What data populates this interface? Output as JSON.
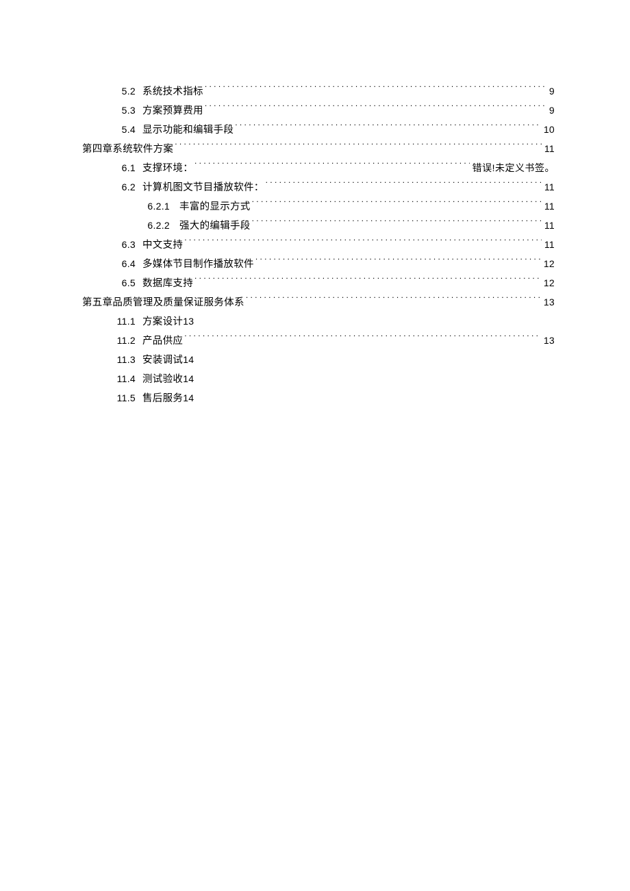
{
  "toc": [
    {
      "level": 1,
      "num": "5.2",
      "title": "系统技术指标",
      "leader": true,
      "page": "9"
    },
    {
      "level": 1,
      "num": "5.3",
      "title": "方案预算费用",
      "leader": true,
      "page": "9"
    },
    {
      "level": 1,
      "num": "5.4",
      "title": "显示功能和编辑手段",
      "leader": true,
      "page": "10"
    },
    {
      "level": 0,
      "num": "",
      "title": "第四章系统软件方案",
      "leader": true,
      "page": "11"
    },
    {
      "level": 1,
      "num": "6.1",
      "title": "支撑环境：",
      "leader": true,
      "page": "错误!未定义书签。",
      "error": true
    },
    {
      "level": 1,
      "num": "6.2",
      "title": "计算机图文节目播放软件：",
      "leader": true,
      "page": "11"
    },
    {
      "level": 2,
      "num": "6.2.1",
      "title": "丰富的显示方式",
      "leader": true,
      "page": "11"
    },
    {
      "level": 2,
      "num": "6.2.2",
      "title": "强大的编辑手段",
      "leader": true,
      "page": "11"
    },
    {
      "level": 1,
      "num": "6.3",
      "title": "中文支持",
      "leader": true,
      "page": "11"
    },
    {
      "level": 1,
      "num": "6.4",
      "title": "多媒体节目制作播放软件",
      "leader": true,
      "page": "12"
    },
    {
      "level": 1,
      "num": "6.5",
      "title": "数据库支持",
      "leader": true,
      "page": "12"
    },
    {
      "level": 0,
      "num": "",
      "title": "第五章品质管理及质量保证服务体系",
      "leader": true,
      "page": "13"
    },
    {
      "level": 1,
      "num": "11.1",
      "title": "方案设计",
      "leader": false,
      "page": "13"
    },
    {
      "level": 1,
      "num": "11.2",
      "title": "产品供应",
      "leader": true,
      "page": "13"
    },
    {
      "level": 1,
      "num": "11.3",
      "title": "安装调试",
      "leader": false,
      "page": "14"
    },
    {
      "level": 1,
      "num": "11.4",
      "title": "测试验收",
      "leader": false,
      "page": "14"
    },
    {
      "level": 1,
      "num": "11.5",
      "title": "售后服务",
      "leader": false,
      "page": "14"
    }
  ]
}
